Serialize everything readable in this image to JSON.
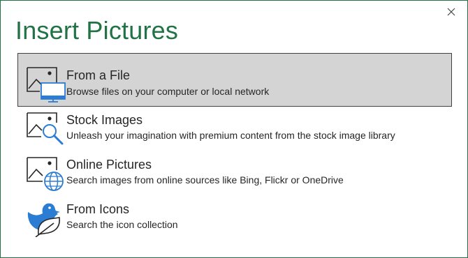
{
  "dialog": {
    "title": "Insert Pictures",
    "close_icon": "close-icon",
    "accent_color": "#217346",
    "selected_color": "#d4d4d4",
    "icon_blue": "#2b7cd3",
    "options": [
      {
        "label": "From a File",
        "description": "Browse files on your computer or local network",
        "icon": "image-computer-icon",
        "selected": true
      },
      {
        "label": "Stock Images",
        "description": "Unleash your imagination with premium content from the stock image library",
        "icon": "image-search-icon",
        "selected": false
      },
      {
        "label": "Online Pictures",
        "description": "Search images from online sources like Bing, Flickr or OneDrive",
        "icon": "image-globe-icon",
        "selected": false
      },
      {
        "label": "From Icons",
        "description": "Search the icon collection",
        "icon": "bird-leaf-icon",
        "selected": false
      }
    ]
  }
}
